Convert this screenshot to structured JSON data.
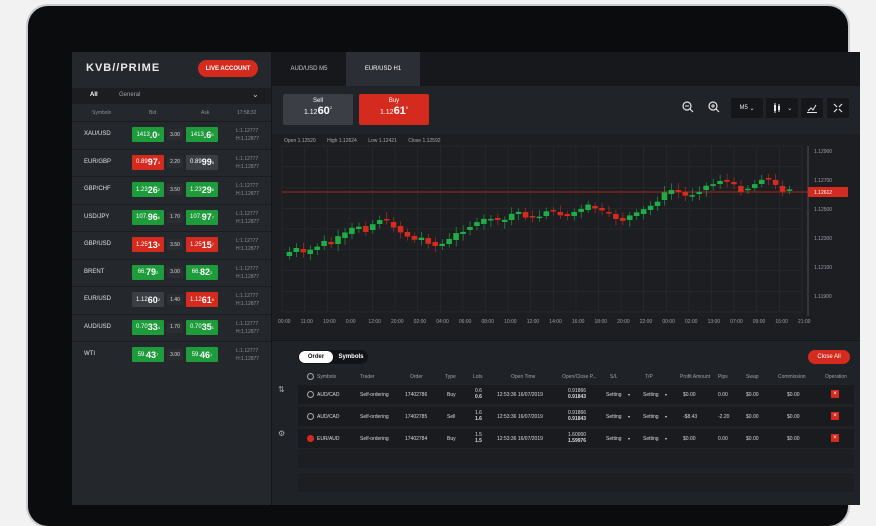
{
  "brand": "KVB//PRIME",
  "live_account": "LIVE ACCOUNT",
  "filter": {
    "all": "All",
    "group": "General"
  },
  "list_header": {
    "symbols": "Symbols",
    "bid": "Bid",
    "ask": "Ask",
    "time": "17:58:32"
  },
  "symbols": [
    {
      "name": "XAU/USD",
      "bid_pre": "1413",
      "bid_big": ".0",
      "bid_sup": "5",
      "bid_color": "green",
      "spread": "3.00",
      "ask_pre": "1413",
      "ask_big": ".6",
      "ask_sup": "5",
      "ask_color": "green",
      "low": "L:1.12777",
      "high": "H:1.12877"
    },
    {
      "name": "EUR/GBP",
      "bid_pre": "0.89",
      "bid_big": "97",
      "bid_sup": "4",
      "bid_color": "red",
      "spread": "2.20",
      "ask_pre": "0.89",
      "ask_big": "99",
      "ask_sup": "5",
      "ask_color": "grey",
      "low": "L:1.12777",
      "high": "H:1.12877"
    },
    {
      "name": "GBP/CHF",
      "bid_pre": "1.23",
      "bid_big": "26",
      "bid_sup": "2",
      "bid_color": "green",
      "spread": "3.50",
      "ask_pre": "1.23",
      "ask_big": "29",
      "ask_sup": "6",
      "ask_color": "green",
      "low": "L:1.12777",
      "high": "H:1.12877"
    },
    {
      "name": "USD/JPY",
      "bid_pre": "107.",
      "bid_big": "96",
      "bid_sup": "6",
      "bid_color": "green",
      "spread": "1.70",
      "ask_pre": "107.",
      "ask_big": "97",
      "ask_sup": "7",
      "ask_color": "green",
      "low": "L:1.12777",
      "high": "H:1.12877"
    },
    {
      "name": "GBP/USD",
      "bid_pre": "1.25",
      "bid_big": "13",
      "bid_sup": "6",
      "bid_color": "red",
      "spread": "3.50",
      "ask_pre": "1.25",
      "ask_big": "15",
      "ask_sup": "7",
      "ask_color": "red",
      "low": "L:1.12777",
      "high": "H:1.12877"
    },
    {
      "name": "BRENT",
      "bid_pre": "66.",
      "bid_big": "79",
      "bid_sup": "2",
      "bid_color": "green",
      "spread": "3.00",
      "ask_pre": "66.",
      "ask_big": "82",
      "ask_sup": "2",
      "ask_color": "green",
      "low": "L:1.12777",
      "high": "H:1.12877"
    },
    {
      "name": "EUR/USD",
      "bid_pre": "1.12",
      "bid_big": "60",
      "bid_sup": "2",
      "bid_color": "grey",
      "spread": "1.40",
      "ask_pre": "1.12",
      "ask_big": "61",
      "ask_sup": "6",
      "ask_color": "red",
      "low": "L:1.12777",
      "high": "H:1.12877"
    },
    {
      "name": "AUD/USD",
      "bid_pre": "0.70",
      "bid_big": "33",
      "bid_sup": "4",
      "bid_color": "green",
      "spread": "1.70",
      "ask_pre": "0.70",
      "ask_big": "35",
      "ask_sup": "1",
      "ask_color": "green",
      "low": "L:1.12777",
      "high": "H:1.12877"
    },
    {
      "name": "WTI",
      "bid_pre": "59.",
      "bid_big": "43",
      "bid_sup": "7",
      "bid_color": "green",
      "spread": "3.00",
      "ask_pre": "59.",
      "ask_big": "46",
      "ask_sup": "1",
      "ask_color": "green",
      "low": "L:1.12777",
      "high": "H:1.12877"
    }
  ],
  "tabs": [
    {
      "label": "AUD/USD  M5"
    },
    {
      "label": "EUR/USD  H1"
    }
  ],
  "trade": {
    "sell_label": "Sell",
    "sell_pre": "1.12",
    "sell_big": "60",
    "sell_sup": "2",
    "buy_label": "Buy",
    "buy_pre": "1.12",
    "buy_big": "61",
    "buy_sup": "6",
    "timeframe": "M5"
  },
  "ohlc": {
    "open": "Open 1.12520",
    "high": "High 1.12624",
    "low": "Low 1.12421",
    "close": "Close 1.12592"
  },
  "chart_data": {
    "type": "candlestick",
    "current_price": "1.12612",
    "y_ticks": [
      "1.12900",
      "1.12700",
      "1.12500",
      "1.12300",
      "1.12100",
      "1.11900"
    ],
    "x_ticks": [
      "00:00",
      "11:00",
      "19:00",
      "0:00",
      "12:00",
      "20:00",
      "02:00",
      "04:00",
      "06:00",
      "08:00",
      "10:00",
      "12:00",
      "14:00",
      "16:00",
      "18:00",
      "20:00",
      "22:00",
      "00:00",
      "02:00",
      "13:00",
      "07:00",
      "09:00",
      "15:00",
      "21:00"
    ]
  },
  "orders": {
    "order_tab": "Order",
    "symbols_tab": "Symbols",
    "close_all": "Close All",
    "columns": [
      "Symbols",
      "Trader",
      "Order",
      "Type",
      "Lots",
      "Open Time",
      "Open/Close P...",
      "S/L",
      "T/P",
      "Profit Amount",
      "Pips",
      "Swap",
      "Commission",
      "Operation"
    ],
    "rows": [
      {
        "symbol": "AUD/CAD",
        "trader": "Self-ordering",
        "order": "17402786",
        "type": "Buy",
        "lots1": "0.6",
        "lots2": "0.6",
        "time": "12:53:36 16/07/2019",
        "price1": "0.91866",
        "price2": "0.91843",
        "sl": "Setting",
        "tp": "Setting",
        "profit": "$0.00",
        "pips": "0.00",
        "swap": "$0.00",
        "commission": "$0.00"
      },
      {
        "symbol": "AUD/CAD",
        "trader": "Self-ordering",
        "order": "17402785",
        "type": "Sell",
        "lots1": "1.6",
        "lots2": "1.6",
        "time": "12:53:36 16/07/2019",
        "price1": "0.91866",
        "price2": "0.91843",
        "sl": "Setting",
        "tp": "Setting",
        "profit": "-$8.43",
        "pips": "-2.20",
        "swap": "$0.00",
        "commission": "$0.00"
      },
      {
        "symbol": "EUR/AUD",
        "trader": "Self-ordering",
        "order": "17402784",
        "type": "Buy",
        "lots1": "1.5",
        "lots2": "1.5",
        "time": "12:53:36 16/07/2019",
        "price1": "1.60000",
        "price2": "1.59976",
        "sl": "Setting",
        "tp": "Setting",
        "profit": "$0.00",
        "pips": "0.00",
        "swap": "$0.00",
        "commission": "$0.00"
      }
    ]
  }
}
